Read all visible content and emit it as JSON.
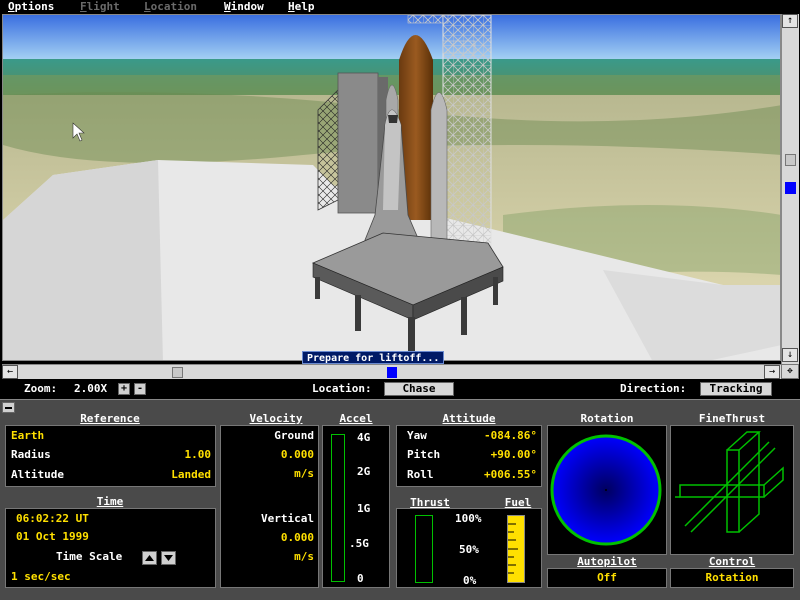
{
  "menu": {
    "options": "Options",
    "flight": "Flight",
    "location": "Location",
    "window": "Window",
    "help": "Help"
  },
  "viewport": {
    "status_message": "Prepare for liftoff..."
  },
  "scrollbars": {
    "up": "↑",
    "down": "↓",
    "left": "←",
    "right": "→",
    "corner": "✥"
  },
  "controls": {
    "zoom_label": "Zoom:",
    "zoom_value": "2.00X",
    "zoom_in": "+",
    "zoom_out": "-",
    "location_label": "Location:",
    "location_value": "Chase",
    "direction_label": "Direction:",
    "direction_value": "Tracking"
  },
  "reference": {
    "header": "Reference",
    "body": "Earth",
    "radius_label": "Radius",
    "radius_value": "1.00",
    "altitude_label": "Altitude",
    "altitude_value": "Landed"
  },
  "time": {
    "header": "Time",
    "clock": "06:02:22 UT",
    "date": "01 Oct 1999",
    "scale_label": "Time Scale",
    "scale_value": "1 sec/sec"
  },
  "velocity": {
    "header": "Velocity",
    "ground_label": "Ground",
    "ground_value": "0.000",
    "ground_unit": "m/s",
    "vertical_label": "Vertical",
    "vertical_value": "0.000",
    "vertical_unit": "m/s"
  },
  "accel": {
    "header": "Accel",
    "ticks": [
      "4G",
      "2G",
      "1G",
      ".5G",
      "0"
    ]
  },
  "attitude": {
    "header": "Attitude",
    "yaw_label": "Yaw",
    "yaw_value": "-084.86°",
    "pitch_label": "Pitch",
    "pitch_value": "+90.00°",
    "roll_label": "Roll",
    "roll_value": "+006.55°"
  },
  "thrust": {
    "header": "Thrust",
    "level": 0
  },
  "fuel": {
    "header": "Fuel",
    "ticks": [
      "100%",
      "50%",
      "0%"
    ],
    "level": 1.0
  },
  "rotation": {
    "header": "Rotation"
  },
  "finethrust": {
    "header": "FineThrust"
  },
  "autopilot": {
    "header": "Autopilot",
    "value": "Off"
  },
  "control": {
    "header": "Control",
    "value": "Rotation"
  },
  "colors": {
    "readout_yellow": "#ffe000",
    "rotation_ball": "#0000ff",
    "rotation_ring": "#00c000",
    "finethrust_lines": "#00c000",
    "fuel_fill": "#ffe000",
    "panel_bg": "#4a4a4a"
  }
}
